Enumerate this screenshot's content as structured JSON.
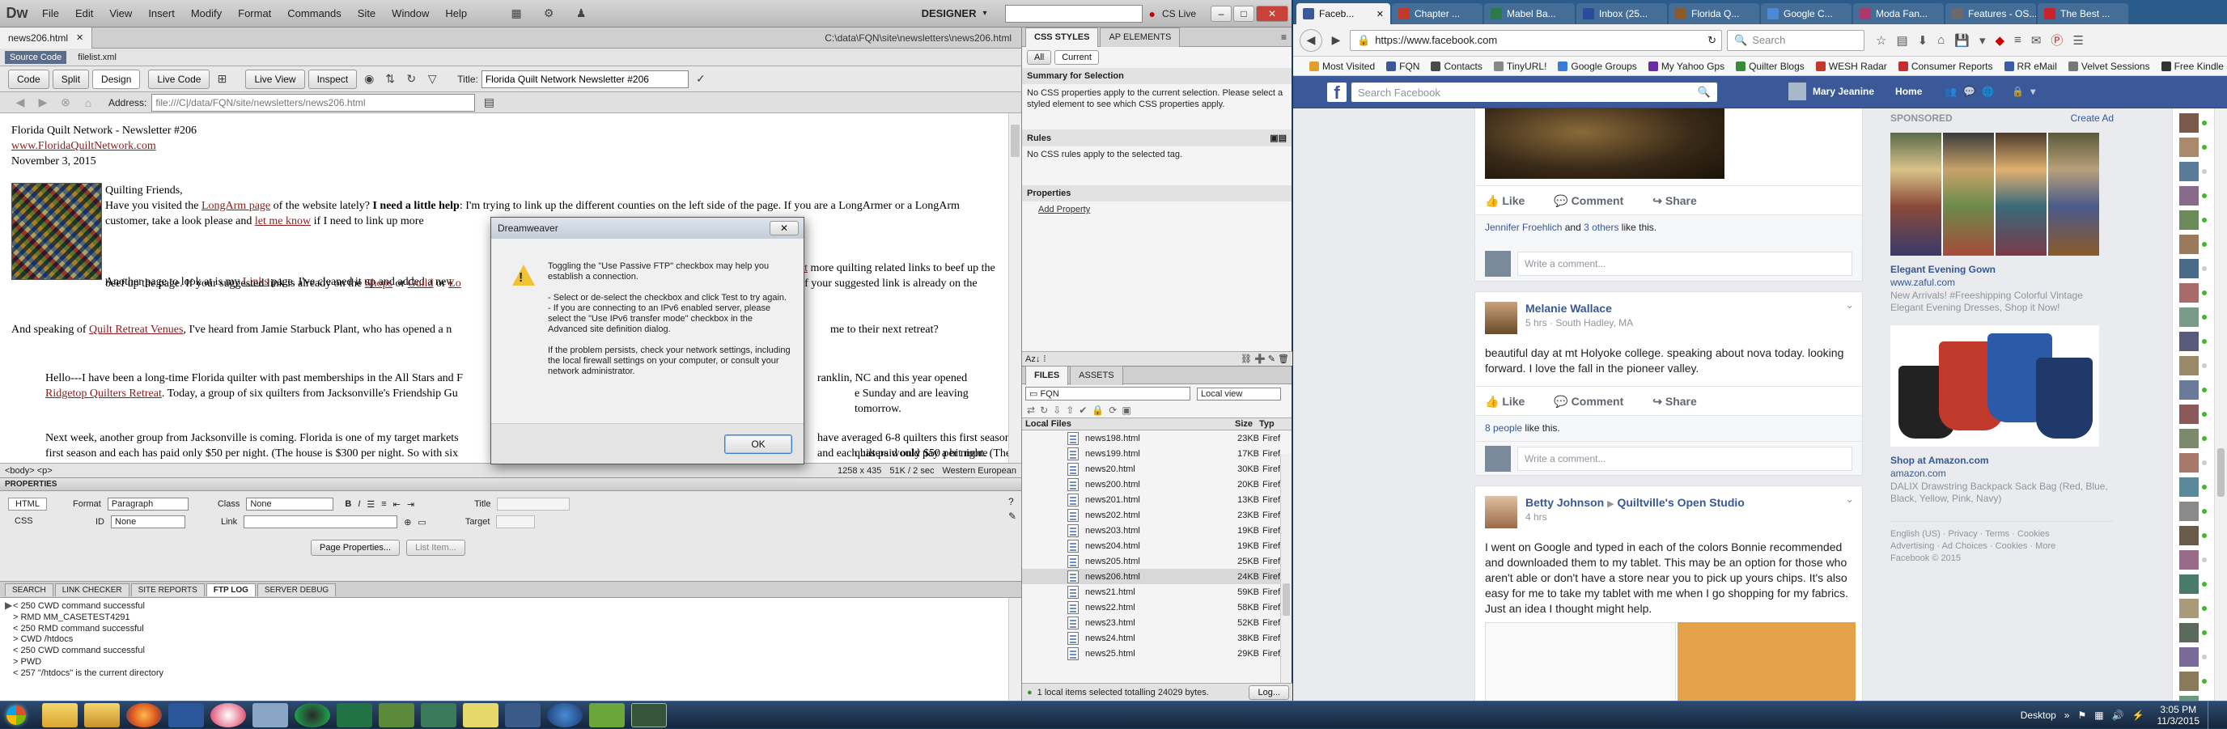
{
  "dw": {
    "logo": "Dw",
    "menus": [
      "File",
      "Edit",
      "View",
      "Insert",
      "Modify",
      "Format",
      "Commands",
      "Site",
      "Window",
      "Help"
    ],
    "workspace": "DESIGNER",
    "search_placeholder": "",
    "cs_live": "CS Live",
    "doc_tabs": [
      "news206.html"
    ],
    "path": "C:\\data\\FQN\\site\\newsletters\\news206.html",
    "related": [
      "Source Code",
      "filelist.xml"
    ],
    "view_buttons": [
      "Code",
      "Split",
      "Design",
      "Live Code",
      "Live View",
      "Inspect"
    ],
    "title_label": "Title:",
    "title_value": "Florida Quilt Network Newsletter #206",
    "address_label": "Address:",
    "address_value": "file:///C|/data/FQN/site/newsletters/news206.html",
    "doc": {
      "h1": "Florida Quilt Network - Newsletter #206",
      "site_link": "www.FloridaQuiltNetwork.com",
      "date": "November 3, 2015",
      "greeting": "Quilting Friends,",
      "p1a": "Have you visited the ",
      "p1_link": "LongArm page",
      "p1b": " of the website lately?  ",
      "p1_bold": "I need a little help",
      "p1c": ":  I'm trying to link up the different counties on the left side of the page.  If you are a LongArmer or a LongArm customer, take a look please and ",
      "p1_link2": "let me know",
      "p1d": " if I need to link up more",
      "p2a": "Another page to look at is my ",
      "p2_link": "Links",
      "p2b": " page.  I've cleaned it up and added a new",
      "p2_link2": "suggest",
      "p2c": " more quilting related links to beef up the page.  If your suggested link is already on the ",
      "p2_link3": "Shops",
      "p2d": " or ",
      "p2_link4": "Guild",
      "p2e": " or ",
      "p2_link5": "Lo",
      "p3a": "And speaking of ",
      "p3_link": "Quilt Retreat Venues",
      "p3b": ",  I've heard from Jamie Starbuck Plant, who has opened a n",
      "p3c": "me to their next retreat?",
      "p4a": "Hello---I have been a long-time Florida quilter with past memberships in the All Stars and F",
      "p4b": "ranklin, NC and this year opened ",
      "p4_link": "Ridgetop Quilters Retreat",
      "p4c": ". Today, a group of six quilters from Jacksonville's Friendship Gu",
      "p4d": "e Sunday and are leaving tomorrow.",
      "p5a": "Next week, another group from Jacksonville is coming. Florida is one of my target markets",
      "p5b": "have averaged 6-8 quilters this first season and each has paid only $50 per night. (The house is $300 per night. So with six",
      "p5c": "quilters would pay a bit more"
    },
    "statusbar": {
      "tags": "<body> <p>",
      "size": "1258 x 435",
      "weight": "51K / 2 sec",
      "encoding": "Western European"
    },
    "properties": {
      "title": "PROPERTIES",
      "html": "HTML",
      "css": "CSS",
      "format_label": "Format",
      "format_value": "Paragraph",
      "class_label": "Class",
      "class_value": "None",
      "id_label": "ID",
      "id_value": "None",
      "link_label": "Link",
      "title_label": "Title",
      "target_label": "Target",
      "page_props": "Page Properties...",
      "list_item": "List Item..."
    },
    "bottom_tabs": [
      "SEARCH",
      "LINK CHECKER",
      "SITE REPORTS",
      "FTP LOG",
      "SERVER DEBUG"
    ],
    "ftp_log": [
      "< 250 CWD command successful",
      "> RMD MM_CASETEST4291",
      "< 250 RMD command successful",
      "> CWD /htdocs",
      "< 250 CWD command successful",
      "> PWD",
      "< 257 \"/htdocs\" is the current directory"
    ],
    "css_panel": {
      "tabs": [
        "CSS STYLES",
        "AP ELEMENTS"
      ],
      "modes": [
        "All",
        "Current"
      ],
      "summary_title": "Summary for Selection",
      "summary_text": "No CSS properties apply to the current selection.  Please select a styled element to see which CSS properties apply.",
      "rules_title": "Rules",
      "rules_text": "No CSS rules apply to the selected tag.",
      "props_title": "Properties",
      "add_prop": "Add Property"
    },
    "files_panel": {
      "tabs": [
        "FILES",
        "ASSETS"
      ],
      "site": "FQN",
      "view": "Local view",
      "col_name": "Local Files",
      "col_size": "Size",
      "col_type": "Typ",
      "files": [
        {
          "name": "news198.html",
          "size": "23KB",
          "type": "Firef"
        },
        {
          "name": "news199.html",
          "size": "17KB",
          "type": "Firef"
        },
        {
          "name": "news20.html",
          "size": "30KB",
          "type": "Firef"
        },
        {
          "name": "news200.html",
          "size": "20KB",
          "type": "Firef"
        },
        {
          "name": "news201.html",
          "size": "13KB",
          "type": "Firef"
        },
        {
          "name": "news202.html",
          "size": "23KB",
          "type": "Firef"
        },
        {
          "name": "news203.html",
          "size": "19KB",
          "type": "Firef"
        },
        {
          "name": "news204.html",
          "size": "19KB",
          "type": "Firef"
        },
        {
          "name": "news205.html",
          "size": "25KB",
          "type": "Firef"
        },
        {
          "name": "news206.html",
          "size": "24KB",
          "type": "Firef"
        },
        {
          "name": "news21.html",
          "size": "59KB",
          "type": "Firef"
        },
        {
          "name": "news22.html",
          "size": "58KB",
          "type": "Firef"
        },
        {
          "name": "news23.html",
          "size": "52KB",
          "type": "Firef"
        },
        {
          "name": "news24.html",
          "size": "38KB",
          "type": "Firef"
        },
        {
          "name": "news25.html",
          "size": "29KB",
          "type": "Firef"
        }
      ],
      "status": "1 local items selected totalling 24029 bytes.",
      "log": "Log..."
    },
    "dialog": {
      "title": "Dreamweaver",
      "line1": "Toggling the \"Use Passive FTP\" checkbox may help you establish a connection.",
      "line2": "- Select or de-select the checkbox and click Test to try again.",
      "line3": "- If you are connecting to an IPv6 enabled server, please select the \"Use IPv6 transfer mode\" checkbox in the Advanced site definition dialog.",
      "line4": "If the problem persists, check your network settings, including the local firewall settings on your computer, or consult your network administrator.",
      "ok": "OK"
    }
  },
  "ff": {
    "tabs": [
      "Faceb...",
      "Chapter ...",
      "Mabel Ba...",
      "Inbox (25...",
      "Florida Q...",
      "Google C...",
      "Moda Fan...",
      "Features - OS...",
      "The Best ..."
    ],
    "url": "https://www.facebook.com",
    "search_placeholder": "Search",
    "bookmarks": [
      "Most Visited",
      "FQN",
      "Contacts",
      "TinyURL!",
      "Google Groups",
      "My Yahoo Gps",
      "Quilter Blogs",
      "WESH Radar",
      "Consumer Reports",
      "RR eMail",
      "Velvet Sessions",
      "Free Kindle"
    ]
  },
  "fb": {
    "search_placeholder": "Search Facebook",
    "user": "Mary Jeanine",
    "home": "Home",
    "actions": [
      "Like",
      "Comment",
      "Share"
    ],
    "likers_a": "Jennifer Froehlich",
    "likers_b": " and ",
    "likers_c": "3 others",
    "likers_d": " like this.",
    "comment_placeholder": "Write a comment...",
    "post2": {
      "author": "Melanie Wallace",
      "meta": "5 hrs · South Hadley, MA",
      "text": "beautiful day at mt Holyoke college. speaking about nova today. looking forward. I love the fall in the pioneer valley.",
      "likes": "8 people",
      "likes_tail": " like this."
    },
    "post3": {
      "author": "Betty Johnson",
      "arrow": "▶",
      "group": "Quiltville's Open Studio",
      "meta": "4 hrs",
      "text": "I went on Google and typed in each of the colors Bonnie recommended and downloaded them to my tablet. This may be an option for those who aren't able or don't have a store near you to pick up yours chips. It's also easy for me to take my tablet with me when I go shopping for my fabrics. Just an idea I thought might help."
    },
    "sponsored": "SPONSORED",
    "create_ad": "Create Ad",
    "ad1": {
      "title": "Elegant Evening Gown",
      "site": "www.zaful.com",
      "text": "New Arrivals! #Freeshipping Colorful Vintage Elegant Evening Dresses, Shop it Now!"
    },
    "ad2": {
      "title": "Shop at Amazon.com",
      "site": "amazon.com",
      "text": "DALIX Drawstring Backpack Sack Bag (Red, Blue, Black, Yellow, Pink, Navy)"
    },
    "footer": [
      "English (US)",
      "Privacy",
      "Terms",
      "Cookies",
      "Advertising",
      "Ad Choices",
      "Cookies",
      "More"
    ],
    "copyright": "Facebook © 2015"
  },
  "taskbar": {
    "desktop": "Desktop",
    "time": "3:05 PM",
    "date": "11/3/2015"
  },
  "colors": {
    "fb_blue": "#3b5998",
    "dw_link": "#8b1a1a",
    "taskbar": "#1c2d44"
  }
}
